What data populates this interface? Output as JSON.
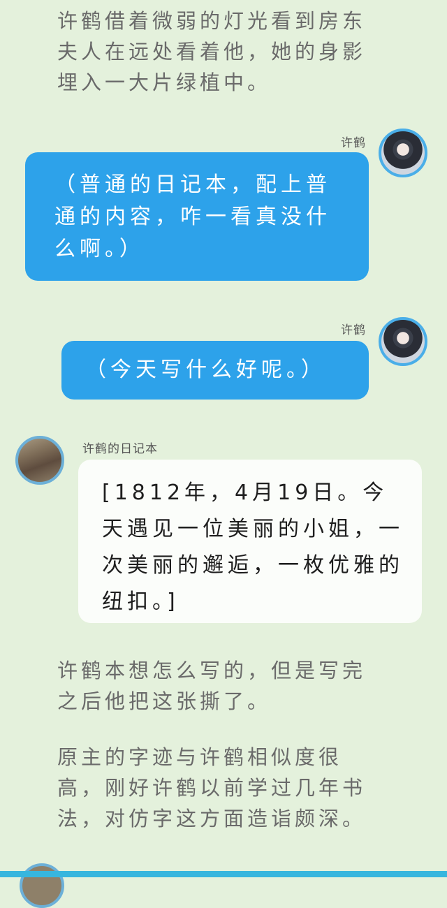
{
  "narration_1": "许鹤借着微弱的灯光看到房东夫人在远处看着他，她的身影埋入一大片绿植中。",
  "message_1": {
    "speaker": "许鹤",
    "text": "（普通的日记本，配上普通的内容，咋一看真没什么啊。）"
  },
  "message_2": {
    "speaker": "许鹤",
    "text": "（今天写什么好呢。）"
  },
  "message_3": {
    "speaker": "许鹤的日记本",
    "text": "[1812年，4月19日。今天遇见一位美丽的小姐，一次美丽的邂逅，一枚优雅的纽扣。]"
  },
  "narration_2": "许鹤本想怎么写的，但是写完之后他把这张撕了。",
  "narration_3": "原主的字迹与许鹤相似度很高，刚好许鹤以前学过几年书法，对仿字这方面造诣颇深。",
  "colors": {
    "background": "#e4f1dc",
    "blue_bubble": "#2da2ea",
    "white_bubble": "#fbfdfa",
    "avatar_ring": "#4aaee8"
  }
}
